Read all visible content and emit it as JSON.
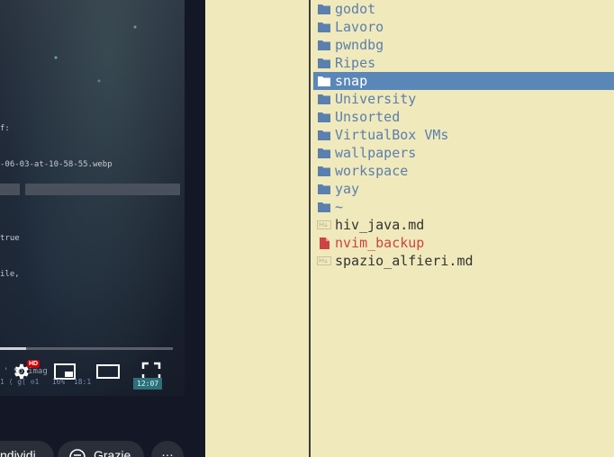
{
  "video": {
    "terminal_lines": [
      "f:",
      "-06-03-at-10-58-55.webp",
      "true",
      "ile,"
    ],
    "status_row": "1 ⟨ g⟨ ⊙1   16%  18:1",
    "overlay_text": "' to imag",
    "clock": "12:07",
    "hd_badge": "HD",
    "progress_fraction": 0.15,
    "buttons": {
      "share_label": "ndividi",
      "thanks_label": "Grazie",
      "more_label": "…"
    }
  },
  "file_list": {
    "entries": [
      {
        "name": "godot",
        "kind": "dir"
      },
      {
        "name": "Lavoro",
        "kind": "dir"
      },
      {
        "name": "pwndbg",
        "kind": "dir"
      },
      {
        "name": "Ripes",
        "kind": "dir"
      },
      {
        "name": "snap",
        "kind": "dir",
        "selected": true
      },
      {
        "name": "University",
        "kind": "dir"
      },
      {
        "name": "Unsorted",
        "kind": "dir"
      },
      {
        "name": "VirtualBox VMs",
        "kind": "dir"
      },
      {
        "name": "wallpapers",
        "kind": "dir"
      },
      {
        "name": "workspace",
        "kind": "dir"
      },
      {
        "name": "yay",
        "kind": "dir"
      },
      {
        "name": "~",
        "kind": "dir"
      },
      {
        "name": "hiv_java.md",
        "kind": "markdown"
      },
      {
        "name": "nvim_backup",
        "kind": "backup"
      },
      {
        "name": "spazio_alfieri.md",
        "kind": "markdown"
      }
    ]
  },
  "colors": {
    "background": "#f0e9bb",
    "directory": "#5b7fae",
    "selection": "#5b87b8",
    "backup_file": "#cc4444",
    "markdown_file": "#333333"
  }
}
